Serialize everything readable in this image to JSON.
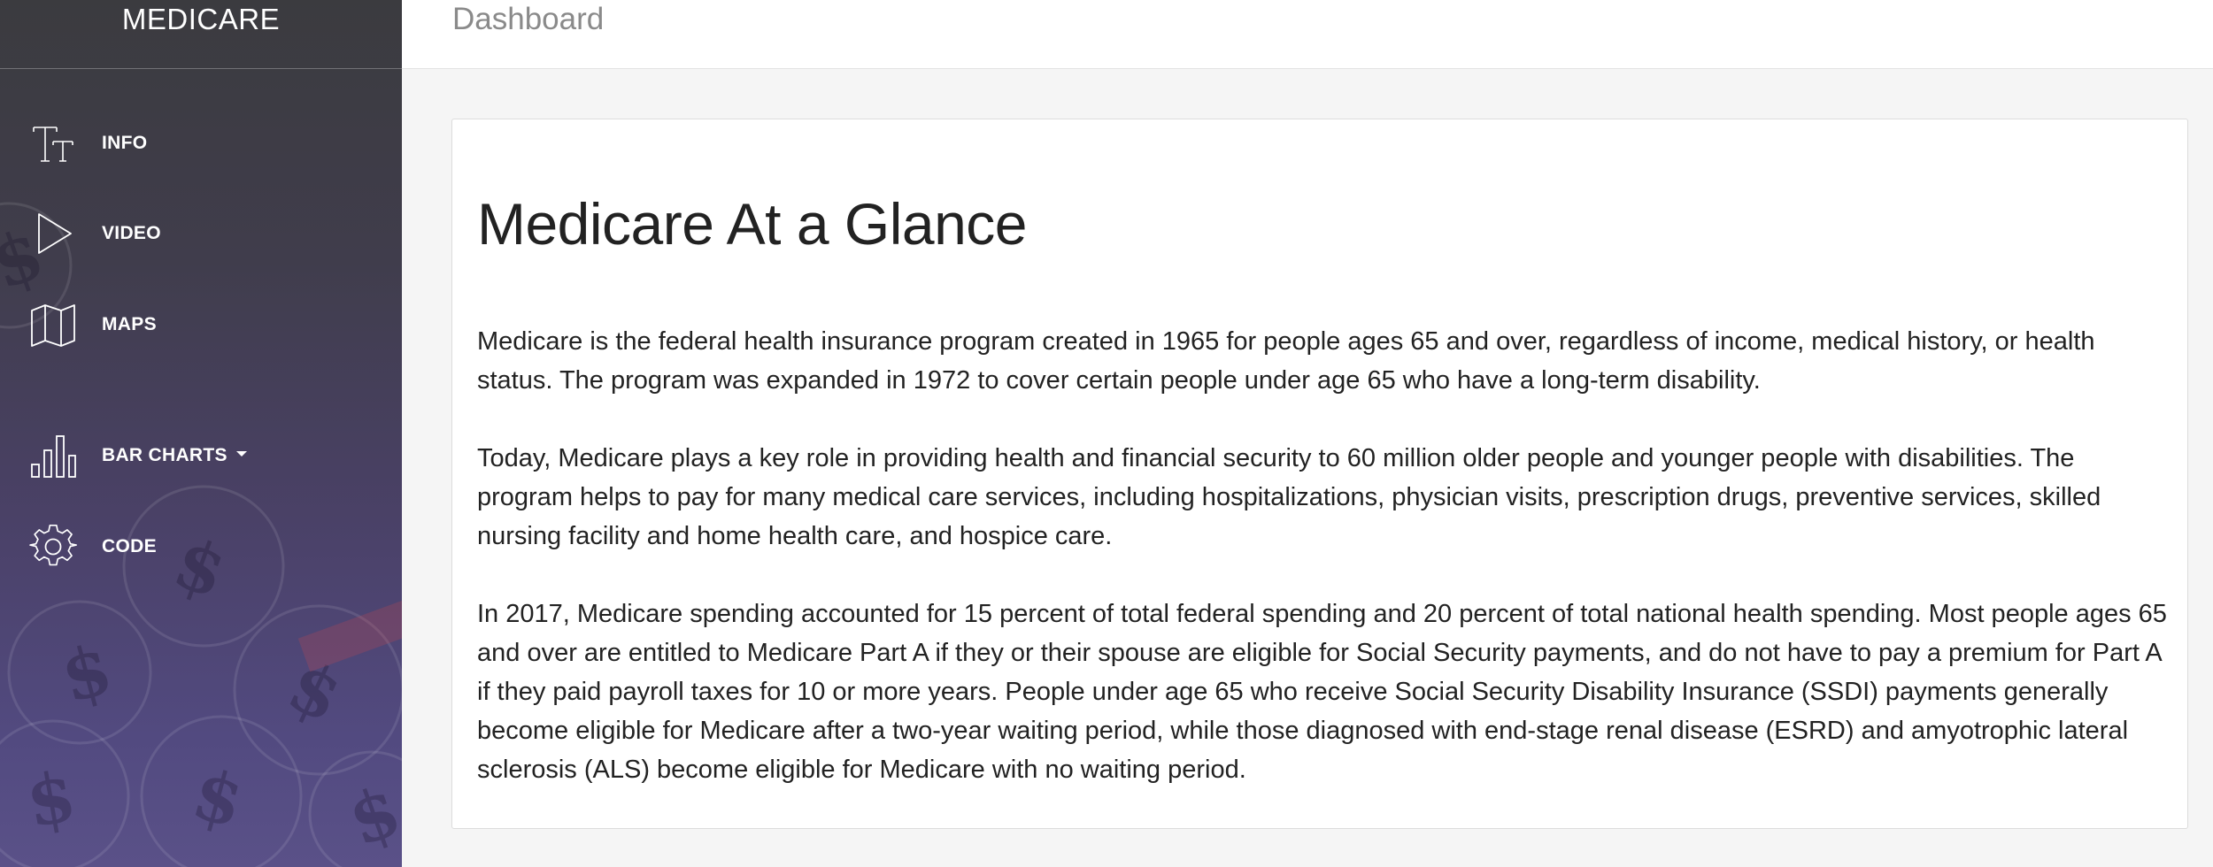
{
  "sidebar": {
    "brand": "MEDICARE",
    "items": [
      {
        "label": "INFO",
        "icon": "text-size-icon"
      },
      {
        "label": "VIDEO",
        "icon": "play-icon"
      },
      {
        "label": "MAPS",
        "icon": "map-icon"
      },
      {
        "label": "BAR CHARTS",
        "icon": "bar-chart-icon",
        "has_dropdown": true
      },
      {
        "label": "CODE",
        "icon": "gear-icon"
      }
    ]
  },
  "header": {
    "title": "Dashboard"
  },
  "main": {
    "heading": "Medicare At a Glance",
    "paragraphs": [
      "Medicare is the federal health insurance program created in 1965 for people ages 65 and over, regardless of income, medical history, or health status. The program was expanded in 1972 to cover certain people under age 65 who have a long-term disability.",
      "Today, Medicare plays a key role in providing health and financial security to 60 million older people and younger people with disabilities. The program helps to pay for many medical care services, including hospitalizations, physician visits, prescription drugs, preventive services, skilled nursing facility and home health care, and hospice care.",
      "In 2017, Medicare spending accounted for 15 percent of total federal spending and 20 percent of total national health spending. Most people ages 65 and over are entitled to Medicare Part A if they or their spouse are eligible for Social Security payments, and do not have to pay a premium for Part A if they paid payroll taxes for 10 or more years. People under age 65 who receive Social Security Disability Insurance (SSDI) payments generally become eligible for Medicare after a two-year waiting period, while those diagnosed with end-stage renal disease (ESRD) and amyotrophic lateral sclerosis (ALS) become eligible for Medicare with no waiting period."
    ]
  },
  "colors": {
    "sidebar_top": "#3b3b3f",
    "sidebar_bottom": "#5a5188",
    "header_text": "#8a8a8a",
    "body_text": "#222222",
    "page_bg": "#f5f5f5"
  }
}
